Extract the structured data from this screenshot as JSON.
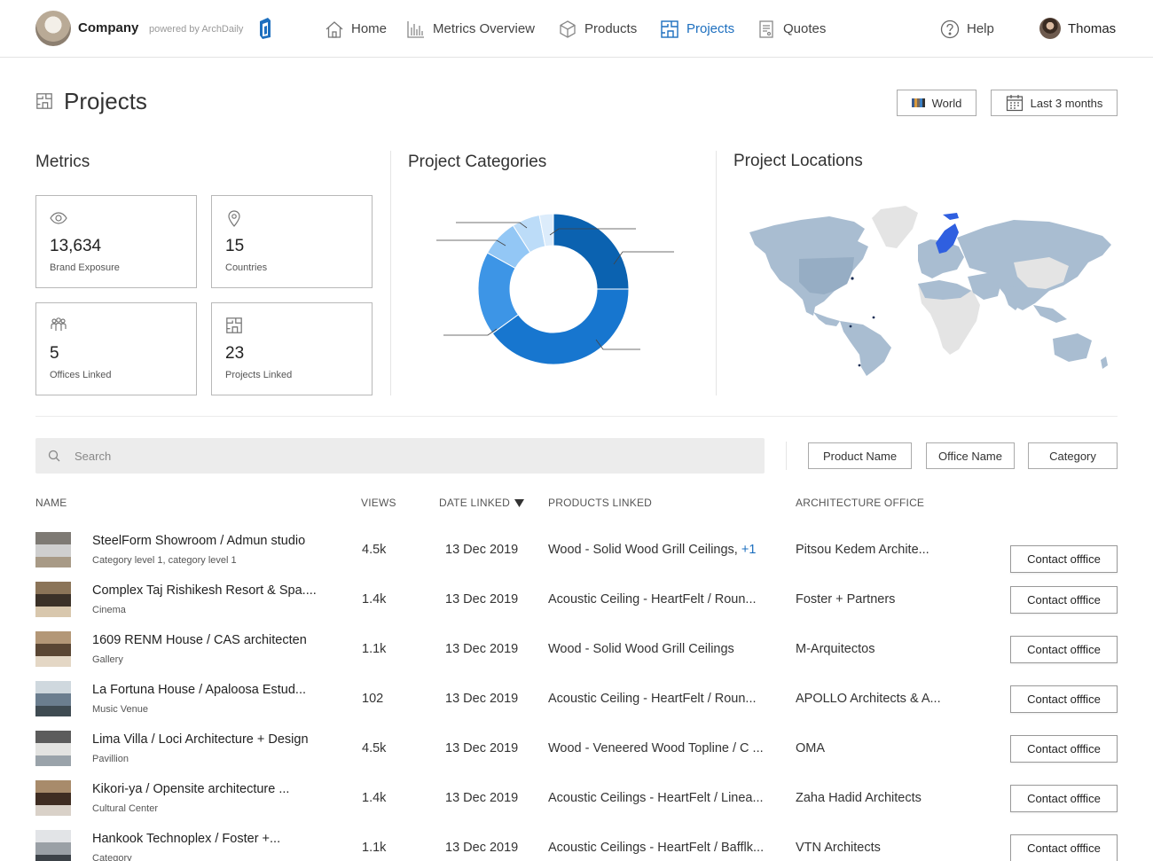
{
  "header": {
    "company": "Company",
    "powered_by": "powered by ArchDaily",
    "nav": [
      {
        "label": "Home",
        "icon": "home-icon"
      },
      {
        "label": "Metrics Overview",
        "icon": "bar-chart-icon"
      },
      {
        "label": "Products",
        "icon": "box-icon"
      },
      {
        "label": "Projects",
        "icon": "floorplan-icon"
      },
      {
        "label": "Quotes",
        "icon": "document-icon"
      }
    ],
    "help": "Help",
    "user": "Thomas",
    "accent": "#1d6fbf"
  },
  "page": {
    "title": "Projects",
    "region_filter": "World",
    "date_filter": "Last 3 months"
  },
  "metrics": {
    "title": "Metrics",
    "cards": [
      {
        "value": "13,634",
        "label": "Brand Exposure",
        "icon": "eye-icon"
      },
      {
        "value": "15",
        "label": "Countries",
        "icon": "location-pin-icon"
      },
      {
        "value": "5",
        "label": "Offices Linked",
        "icon": "people-icon"
      },
      {
        "value": "23",
        "label": "Projects Linked",
        "icon": "floorplan-icon"
      }
    ]
  },
  "categories": {
    "title": "Project Categories",
    "chart_data": {
      "type": "pie",
      "donut": true,
      "slices": [
        {
          "value": 25,
          "color": "#0b62b0"
        },
        {
          "value": 40,
          "color": "#1776cf"
        },
        {
          "value": 18,
          "color": "#3d95e6"
        },
        {
          "value": 8,
          "color": "#93c7f5"
        },
        {
          "value": 6,
          "color": "#bcdcf8"
        },
        {
          "value": 3,
          "color": "#dcecfb"
        }
      ]
    }
  },
  "locations": {
    "title": "Project Locations",
    "land_color": "#a8c0d6",
    "highlight_color": "#2d5ee0",
    "empty_color": "#e4e4e4"
  },
  "search": {
    "placeholder": "Search"
  },
  "filters": [
    "Product Name",
    "Office Name",
    "Category"
  ],
  "table": {
    "headers": {
      "name": "NAME",
      "views": "VIEWS",
      "date": "DATE LINKED",
      "products": "PRODUCTS LINKED",
      "office": "ARCHITECTURE OFFICE"
    },
    "contact_label": "Contact offfice",
    "rows": [
      {
        "name": "SteelForm Showroom / Admun studio",
        "category": "Category level 1, category level 1",
        "views": "4.5k",
        "date": "13 Dec 2019",
        "products": "Wood - Solid Wood Grill Ceilings, ",
        "extra": "+1",
        "office": "Pitsou Kedem Archite..."
      },
      {
        "name": "Complex Taj Rishikesh Resort & Spa....",
        "category": "Cinema",
        "views": "1.4k",
        "date": "13 Dec 2019",
        "products": "Acoustic Ceiling - HeartFelt / Roun...",
        "extra": "",
        "office": "Foster + Partners"
      },
      {
        "name": "1609 RENM House / CAS architecten",
        "category": "Gallery",
        "views": "1.1k",
        "date": "13 Dec 2019",
        "products": "Wood - Solid Wood Grill Ceilings",
        "extra": "",
        "office": "M-Arquitectos"
      },
      {
        "name": "La Fortuna House / Apaloosa Estud...",
        "category": "Music Venue",
        "views": "102",
        "date": "13 Dec 2019",
        "products": "Acoustic Ceiling - HeartFelt / Roun...",
        "extra": "",
        "office": "APOLLO Architects & A..."
      },
      {
        "name": "Lima Villa / Loci Architecture + Design",
        "category": "Pavillion",
        "views": "4.5k",
        "date": "13 Dec 2019",
        "products": "Wood - Veneered Wood Topline / C ...",
        "extra": "",
        "office": "OMA"
      },
      {
        "name": "Kikori-ya / Opensite architecture ...",
        "category": "Cultural Center",
        "views": "1.4k",
        "date": "13 Dec 2019",
        "products": "Acoustic Ceilings - HeartFelt / Linea...",
        "extra": "",
        "office": "Zaha Hadid Architects"
      },
      {
        "name": "Hankook Technoplex / Foster +...",
        "category": "Category",
        "views": "1.1k",
        "date": "13 Dec 2019",
        "products": "Acoustic Ceilings - HeartFelt / Bafflk...",
        "extra": "",
        "office": "VTN Architects"
      }
    ]
  }
}
